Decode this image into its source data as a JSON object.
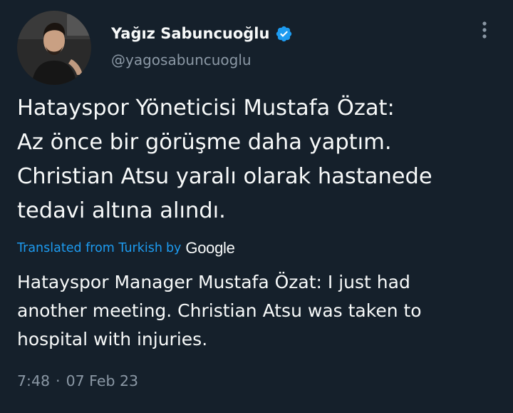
{
  "author": {
    "name": "Yağız Sabuncuoğlu",
    "handle": "@yagosabuncuoglu",
    "verified": true
  },
  "icons": {
    "verified": "verified-badge-icon",
    "more": "more-vertical-icon"
  },
  "colors": {
    "background": "#15202b",
    "text": "#f7f9f9",
    "secondary_text": "#8b98a5",
    "link": "#1d9bf0"
  },
  "tweet": {
    "lines": [
      "Hatayspor Yöneticisi Mustafa Özat:",
      "Az önce bir görüşme daha yaptım.",
      "Christian Atsu yaralı olarak hastanede",
      "tedavi altına alındı."
    ]
  },
  "translation": {
    "link_label": "Translated from Turkish",
    "by_label": "by",
    "provider": "Google",
    "lines": [
      "Hatayspor Manager Mustafa Özat: I just had",
      "another meeting. Christian Atsu was taken to",
      "hospital with injuries."
    ]
  },
  "timestamp": {
    "time": "7:48",
    "separator": "·",
    "date": "07 Feb 23"
  }
}
